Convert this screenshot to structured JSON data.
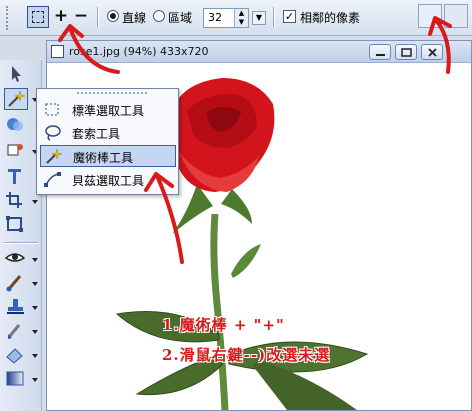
{
  "options_bar": {
    "add_label": "+",
    "subtract_label": "−",
    "mode_options": [
      {
        "label": "直線",
        "selected": true
      },
      {
        "label": "區域",
        "selected": false
      }
    ],
    "tolerance_value": "32",
    "contiguous_label": "相鄰的像素",
    "contiguous_checked": true,
    "check_mark": "✓"
  },
  "toolbox": {
    "tools": [
      {
        "name": "pointer-tool",
        "icon": "pointer-icon"
      },
      {
        "name": "selection-tool",
        "icon": "magic-wand-icon",
        "active": true
      },
      {
        "name": "shape-tool",
        "icon": "shape-icon"
      },
      {
        "name": "fill-tool",
        "icon": "fill-icon"
      },
      {
        "name": "text-tool",
        "icon": "text-icon"
      },
      {
        "name": "crop-tool",
        "icon": "crop-icon"
      },
      {
        "name": "resize-tool",
        "icon": "resize-icon"
      },
      {
        "name": "redeye-tool",
        "icon": "eye-icon"
      },
      {
        "name": "brush-tool",
        "icon": "brush-icon"
      },
      {
        "name": "stamp-tool",
        "icon": "stamp-icon"
      },
      {
        "name": "paint-tool",
        "icon": "paint-icon"
      },
      {
        "name": "eraser-tool",
        "icon": "eraser-icon"
      },
      {
        "name": "gradient-tool",
        "icon": "gradient-icon"
      }
    ]
  },
  "document": {
    "title": "rose1.jpg (94%) 433x720",
    "controls": [
      "minimize",
      "restore",
      "close"
    ]
  },
  "flyout": {
    "items": [
      {
        "label": "標準選取工具",
        "icon": "rectangle-select-icon",
        "selected": false
      },
      {
        "label": "套索工具",
        "icon": "lasso-icon",
        "selected": false
      },
      {
        "label": "魔術棒工具",
        "icon": "magic-wand-icon",
        "selected": true
      },
      {
        "label": "貝茲選取工具",
        "icon": "bezier-icon",
        "selected": false
      }
    ]
  },
  "annotations": {
    "line1": "1.魔術棒 + \"+\"",
    "line2": "2.滑鼠右鍵--)改選未選",
    "annotation_color": "#d81a1a"
  },
  "colors": {
    "accent": "#3e5f9e",
    "rose_red": "#d4141c",
    "stem_green": "#5f8a3a"
  }
}
